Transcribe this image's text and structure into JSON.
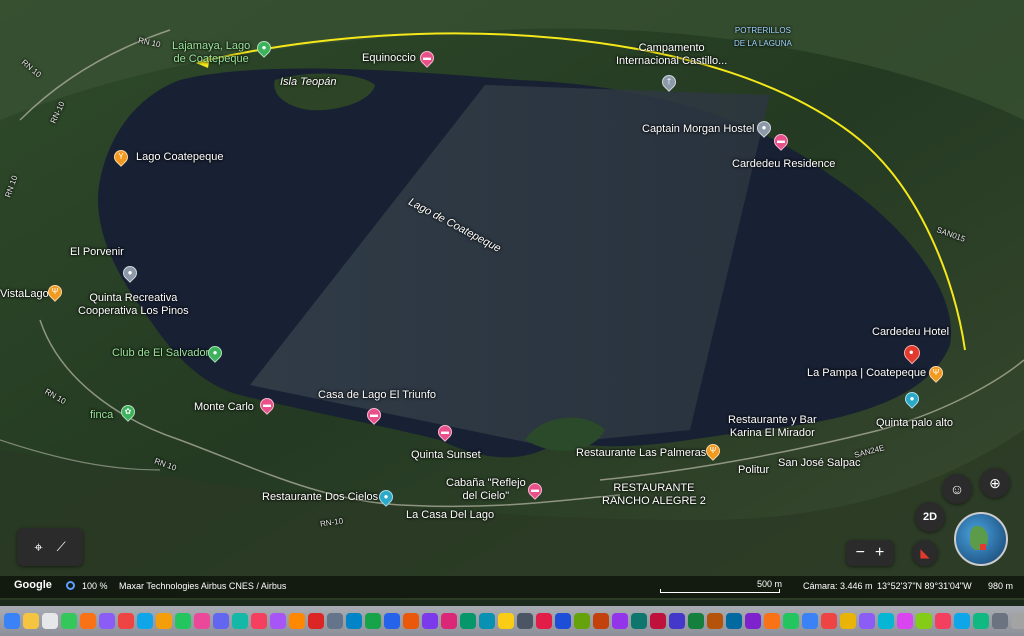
{
  "map": {
    "lake_name": "Lago de Coatepeque",
    "island": "Isla Teopán",
    "region_label": "POTRERILLOS\nDE LA LAGUNA",
    "roads": [
      "RN 10",
      "RN-10",
      "RN 10",
      "RN 10",
      "RN-10",
      "RN 10",
      "RN 10",
      "SAN015",
      "SAN24E"
    ],
    "places": [
      {
        "name": "Lajamaya, Lago\nde Coatepeque",
        "icon": "green-pin",
        "style": "green"
      },
      {
        "name": "Equinoccio",
        "icon": "hotel-pin"
      },
      {
        "name": "Campamento\nInternacional Castillo...",
        "icon": "gray-pin"
      },
      {
        "name": "Captain Morgan Hostel",
        "icon": "gray-pin"
      },
      {
        "name": "Cardedeu Residence",
        "icon": "hotel-pin"
      },
      {
        "name": "Lago Coatepeque",
        "icon": "bar-pin"
      },
      {
        "name": "El Porvenir",
        "icon": "gray-pin"
      },
      {
        "name": "VistaLago",
        "icon": "food-pin"
      },
      {
        "name": "Quinta Recreativa\nCooperativa Los Pinos",
        "icon": "none"
      },
      {
        "name": "Club de El Salvador",
        "icon": "green-pin",
        "style": "green"
      },
      {
        "name": "Monte Carlo",
        "icon": "hotel-pin"
      },
      {
        "name": "Casa de Lago El Triunfo",
        "icon": "hotel-pin"
      },
      {
        "name": "Quinta Sunset",
        "icon": "hotel-pin"
      },
      {
        "name": "finca",
        "icon": "green-pin",
        "style": "green"
      },
      {
        "name": "Restaurante Las Palmeras",
        "icon": "food-pin"
      },
      {
        "name": "Restaurante y Bar\nKarina El Mirador",
        "icon": "none"
      },
      {
        "name": "Politur",
        "icon": "none"
      },
      {
        "name": "San José Salpac",
        "icon": "none"
      },
      {
        "name": "Cardedeu Hotel",
        "icon": "none"
      },
      {
        "name": "La Pampa | Coatepeque",
        "icon": "food-pin"
      },
      {
        "name": "Quinta palo alto",
        "icon": "teal-pin"
      },
      {
        "name": "Cabaña \"Reflejo\ndel Cielo\"",
        "icon": "hotel-pin"
      },
      {
        "name": "RESTAURANTE\nRANCHO ALEGRE 2",
        "icon": "none"
      },
      {
        "name": "Restaurante Dos Cielos",
        "icon": "teal-pin"
      },
      {
        "name": "La Casa Del Lago",
        "icon": "none"
      }
    ],
    "accent_arc_color": "#f5e81a",
    "lake_color": "#1a2234"
  },
  "controls": {
    "mode_2d": "2D",
    "zoom_out": "−",
    "zoom_in": "+"
  },
  "status_bar": {
    "logo": "Google",
    "zoom": "100 %",
    "attribution": "Maxar Technologies  Airbus  CNES / Airbus",
    "scale": "500 m",
    "camera": "Cámara: 3.446 m",
    "coords": "13°52'37\"N 89°31'04\"W",
    "elevation": "980 m"
  },
  "dock": {
    "icon_colors": [
      "#3b82f6",
      "#f5c542",
      "#e5e7eb",
      "#34c759",
      "#f97316",
      "#8b5cf6",
      "#ef4444",
      "#0ea5e9",
      "#f59e0b",
      "#22c55e",
      "#ec4899",
      "#6366f1",
      "#14b8a6",
      "#f43f5e",
      "#a855f7",
      "#ff8800",
      "#dc2626",
      "#64748b",
      "#0284c7",
      "#16a34a",
      "#2563eb",
      "#ea580c",
      "#7c3aed",
      "#db2777",
      "#059669",
      "#0891b2",
      "#facc15",
      "#4b5563",
      "#e11d48",
      "#1d4ed8",
      "#65a30d",
      "#c2410c",
      "#9333ea",
      "#0f766e",
      "#be123c",
      "#4338ca",
      "#15803d",
      "#b45309",
      "#0369a1",
      "#7e22ce",
      "#f97316",
      "#22c55e",
      "#3b82f6",
      "#ef4444",
      "#eab308",
      "#8b5cf6",
      "#06b6d4",
      "#d946ef",
      "#84cc16",
      "#f43f5e",
      "#0ea5e9",
      "#10b981",
      "#6b7280",
      "#a3a3a3",
      "#1e293b"
    ]
  }
}
